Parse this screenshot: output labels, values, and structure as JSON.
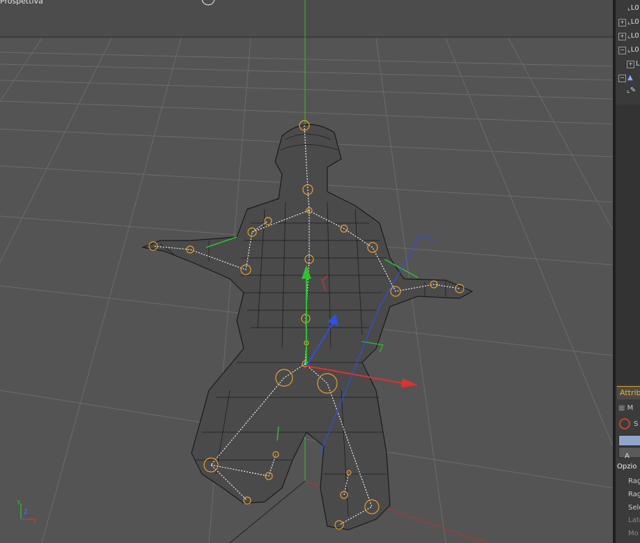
{
  "viewport": {
    "label": "Prospettiva",
    "axis_gizmo": {
      "y": "Y",
      "z": "Z",
      "x": "X"
    }
  },
  "object_tree": {
    "rows": [
      {
        "text": "L0"
      },
      {
        "text": "L0"
      },
      {
        "text": "L0"
      },
      {
        "text": "L0"
      },
      {
        "text": "L"
      }
    ]
  },
  "attributes": {
    "tab_label": "Attrib",
    "mode_label": "M",
    "selection_label": "S",
    "button_a_label": "A",
    "section_title": "Opzio",
    "fields": [
      "Rag",
      "Rag",
      "Sele",
      "Late",
      "Mo"
    ]
  },
  "colors": {
    "viewport_bg": "#545454",
    "grid": "#6a6a6a",
    "mesh": "#1a1a1a",
    "joint": "#e8a030",
    "axis_x": "#e03030",
    "axis_y": "#30c030",
    "axis_z": "#3050e0",
    "accent": "#f0b030"
  }
}
